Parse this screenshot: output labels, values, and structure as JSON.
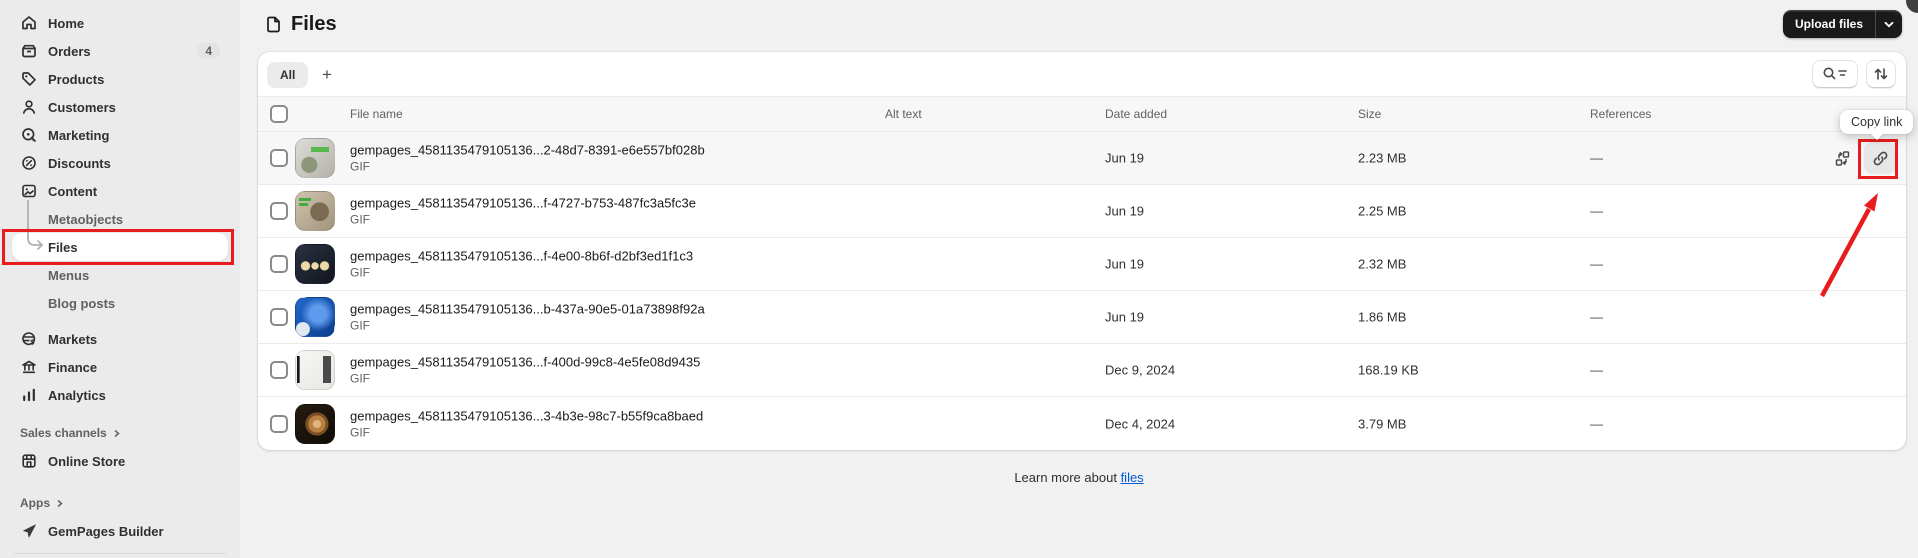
{
  "sidebar": {
    "items": [
      {
        "label": "Home",
        "icon": "home-icon"
      },
      {
        "label": "Orders",
        "icon": "orders-icon",
        "badge": "4"
      },
      {
        "label": "Products",
        "icon": "products-icon"
      },
      {
        "label": "Customers",
        "icon": "customers-icon"
      },
      {
        "label": "Marketing",
        "icon": "marketing-icon"
      },
      {
        "label": "Discounts",
        "icon": "discounts-icon"
      },
      {
        "label": "Content",
        "icon": "content-icon"
      }
    ],
    "content_subitems": [
      {
        "label": "Metaobjects",
        "active": false
      },
      {
        "label": "Files",
        "active": true
      },
      {
        "label": "Menus",
        "active": false
      },
      {
        "label": "Blog posts",
        "active": false
      }
    ],
    "secondary_items": [
      {
        "label": "Markets",
        "icon": "markets-icon"
      },
      {
        "label": "Finance",
        "icon": "finance-icon"
      },
      {
        "label": "Analytics",
        "icon": "analytics-icon"
      }
    ],
    "sales_channels_label": "Sales channels",
    "online_store": {
      "label": "Online Store",
      "icon": "storefront-icon"
    },
    "apps_label": "Apps",
    "gempages": {
      "label": "GemPages Builder",
      "icon": "gempages-icon"
    }
  },
  "header": {
    "title": "Files",
    "upload_button_label": "Upload files"
  },
  "toolbar": {
    "all_tab_label": "All",
    "add_view_label": "+"
  },
  "table": {
    "columns": [
      "File name",
      "Alt text",
      "Date added",
      "Size",
      "References"
    ],
    "rows": [
      {
        "name": "gempages_4581135479105136...2-48d7-8391-e6e557bf028b",
        "type": "GIF",
        "date": "Jun 19",
        "size": "2.23 MB",
        "references": "—"
      },
      {
        "name": "gempages_4581135479105136...f-4727-b753-487fc3a5fc3e",
        "type": "GIF",
        "date": "Jun 19",
        "size": "2.25 MB",
        "references": "—"
      },
      {
        "name": "gempages_4581135479105136...f-4e00-8b6f-d2bf3ed1f1c3",
        "type": "GIF",
        "date": "Jun 19",
        "size": "2.32 MB",
        "references": "—"
      },
      {
        "name": "gempages_4581135479105136...b-437a-90e5-01a73898f92a",
        "type": "GIF",
        "date": "Jun 19",
        "size": "1.86 MB",
        "references": "—"
      },
      {
        "name": "gempages_4581135479105136...f-400d-99c8-4e5fe08d9435",
        "type": "GIF",
        "date": "Dec 9, 2024",
        "size": "168.19 KB",
        "references": "—"
      },
      {
        "name": "gempages_4581135479105136...3-4b3e-98c7-b55f9ca8baed",
        "type": "GIF",
        "date": "Dec 4, 2024",
        "size": "3.79 MB",
        "references": "—"
      }
    ]
  },
  "tooltip": {
    "label": "Copy link"
  },
  "footer": {
    "prefix": "Learn more about",
    "link_label": "files"
  },
  "colors": {
    "annotation_red": "#e81c1c",
    "link_blue": "#005bd3",
    "primary_button": "#1a1a1a",
    "sidebar_bg": "#ebebeb",
    "page_bg": "#f1f1f1"
  }
}
